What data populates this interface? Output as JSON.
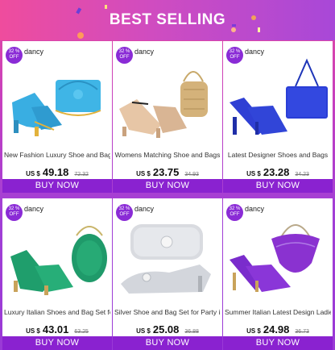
{
  "header": {
    "title": "BEST SELLING"
  },
  "colors": {
    "accent": "#8a22d0",
    "header_start": "#ef4c9d",
    "header_end": "#a848d8"
  },
  "products": [
    {
      "discount": "32 % OFF",
      "brand": "dancy",
      "title": "New Fashion Luxury Shoe and Bag",
      "currency": "US $",
      "price": "49.18",
      "old_price": "72.32",
      "button": "BUY NOW",
      "image": "blue-sandal-and-bag"
    },
    {
      "discount": "32 % OFF",
      "brand": "dancy",
      "title": "Womens Matching Shoe and Bags",
      "currency": "US $",
      "price": "23.75",
      "old_price": "34.93",
      "button": "BUY NOW",
      "image": "nude-sandal-and-gold-bag"
    },
    {
      "discount": "32 % OFF",
      "brand": "dancy",
      "title": "Latest Designer Shoes and Bags",
      "currency": "US $",
      "price": "23.28",
      "old_price": "34.23",
      "button": "BUY NOW",
      "image": "royal-blue-pump-and-bag"
    },
    {
      "discount": "32 % OFF",
      "brand": "dancy",
      "title": "Luxury Italian Shoes and Bag Set for",
      "currency": "US $",
      "price": "43.01",
      "old_price": "63.25",
      "button": "BUY NOW",
      "image": "green-sandal-and-bag"
    },
    {
      "discount": "32 % OFF",
      "brand": "dancy",
      "title": "Silver Shoe and Bag Set for Party in",
      "currency": "US $",
      "price": "25.08",
      "old_price": "36.88",
      "button": "BUY NOW",
      "image": "silver-shoe-and-clutch"
    },
    {
      "discount": "32 % OFF",
      "brand": "dancy",
      "title": "Summer Italian Latest Design Ladies",
      "currency": "US $",
      "price": "24.98",
      "old_price": "36.73",
      "button": "BUY NOW",
      "image": "purple-sandal-and-bag"
    }
  ]
}
